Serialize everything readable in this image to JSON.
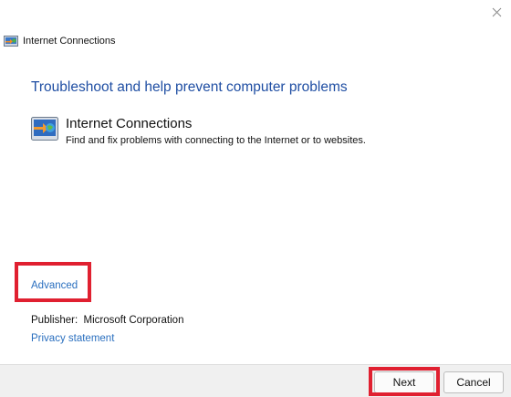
{
  "window": {
    "title": "Internet Connections",
    "close_icon": "close-icon",
    "app_icon": "network-troubleshooter-icon"
  },
  "main": {
    "heading": "Troubleshoot and help prevent computer problems",
    "item": {
      "icon": "network-troubleshooter-icon",
      "title": "Internet Connections",
      "description": "Find and fix problems with connecting to the Internet or to websites."
    },
    "advanced_link": "Advanced",
    "publisher": {
      "label": "Publisher:",
      "value": "Microsoft Corporation"
    },
    "privacy_link": "Privacy statement"
  },
  "footer": {
    "next_label": "Next",
    "cancel_label": "Cancel"
  },
  "colors": {
    "heading": "#1f4ea3",
    "link": "#2a6fbf",
    "highlight": "#e02030",
    "footer_bg": "#f0f0f0"
  }
}
